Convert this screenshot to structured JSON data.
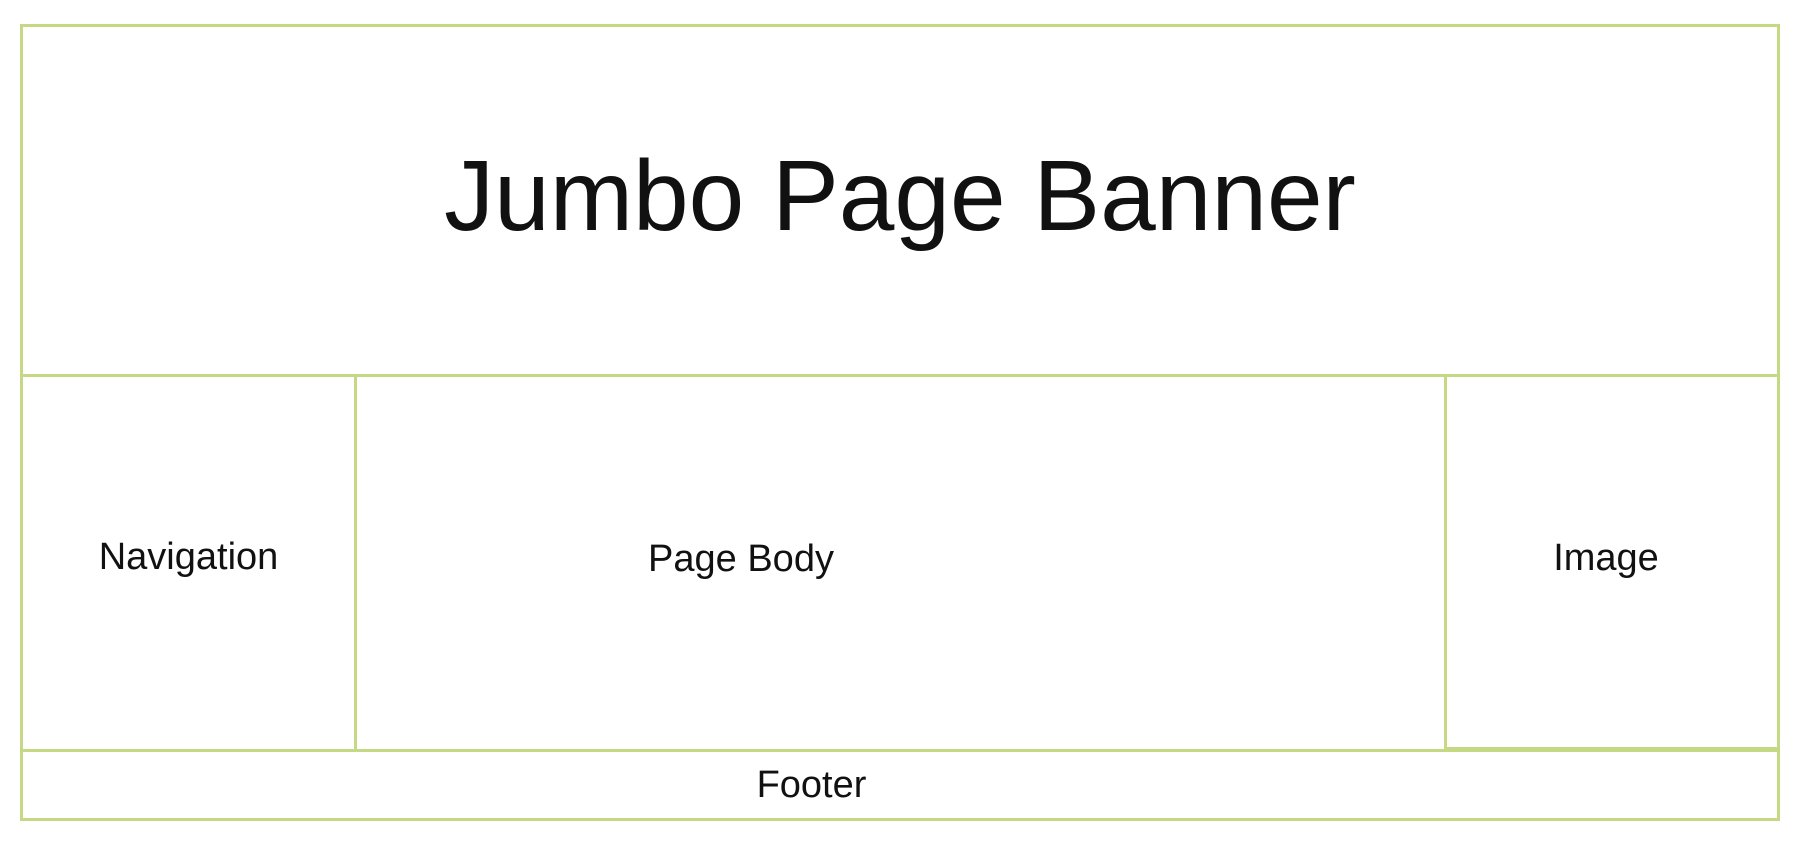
{
  "diagram": {
    "banner": "Jumbo Page Banner",
    "navigation": "Navigation",
    "page_body": "Page Body",
    "image": "Image",
    "footer": "Footer"
  },
  "colors": {
    "border": "#c5d985",
    "text": "#111111",
    "background": "#ffffff"
  }
}
